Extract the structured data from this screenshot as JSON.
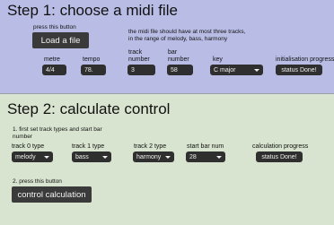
{
  "step1": {
    "title": "Step 1: choose a midi file",
    "press_hint": "press this button",
    "load_button": "Load a file",
    "info_line1": "the midi file should have at most three tracks,",
    "info_line2": "in the range of melody, bass, harmony",
    "metre_label": "metre",
    "metre_value": "4/4",
    "tempo_label": "tempo",
    "tempo_value": "78.",
    "track_number_label_1": "track",
    "track_number_label_2": "number",
    "track_number_value": "3",
    "bar_number_label_1": "bar",
    "bar_number_label_2": "number",
    "bar_number_value": "58",
    "key_label": "key",
    "key_value": "C major",
    "init_progress_label": "initialisation  progress",
    "init_status": "status Done!"
  },
  "step2": {
    "title": "Step 2: calculate control",
    "instruction1_line1": "1. first set track types and start bar",
    "instruction1_line2": "number",
    "track0_label": "track 0 type",
    "track0_value": "melody",
    "track1_label": "track 1 type",
    "track1_value": "bass",
    "track2_label": "track 2 type",
    "track2_value": "harmony",
    "start_bar_label": "start bar num",
    "start_bar_value": "28",
    "calc_progress_label": "calculation  progress",
    "calc_status": "status Done!",
    "instruction2": "2. press this button",
    "control_button": "control calculation"
  }
}
